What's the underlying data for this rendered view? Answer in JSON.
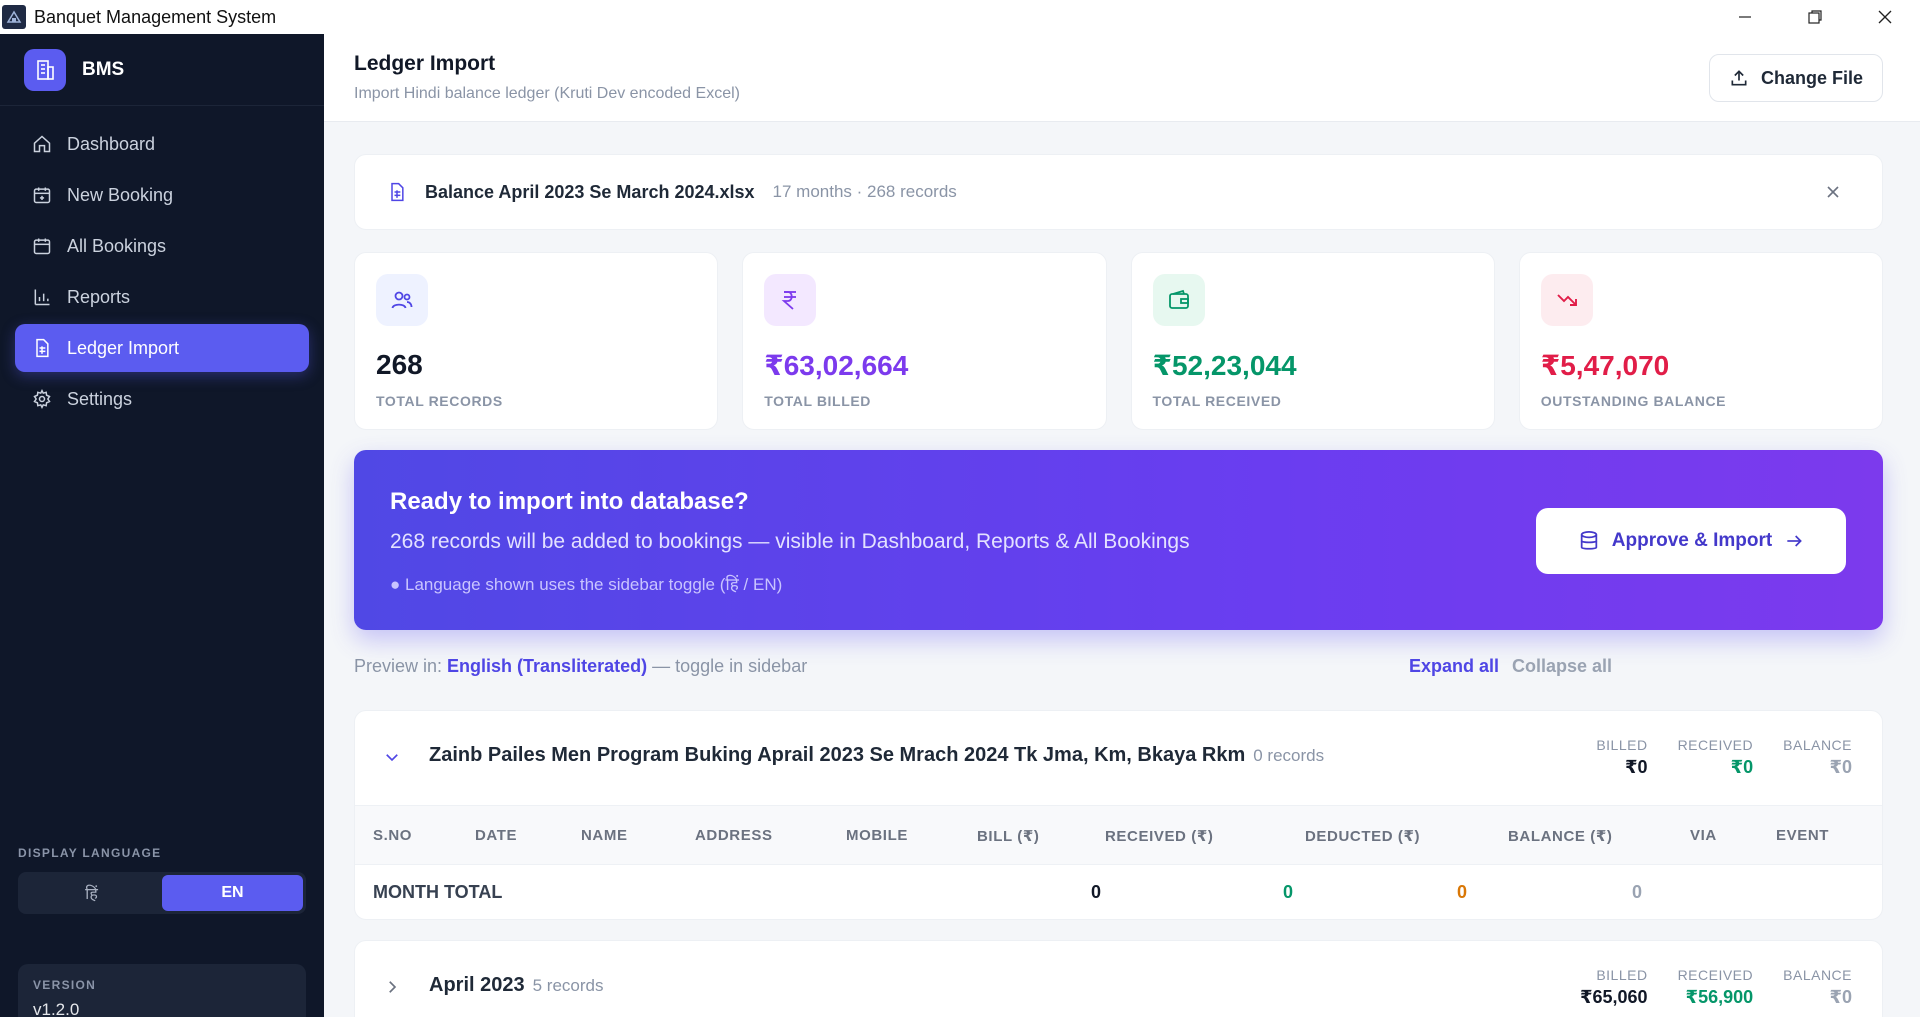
{
  "window": {
    "title": "Banquet Management System"
  },
  "sidebar": {
    "brand": "BMS",
    "items": [
      {
        "label": "Dashboard",
        "icon": "home-icon"
      },
      {
        "label": "New Booking",
        "icon": "calendar-plus-icon"
      },
      {
        "label": "All Bookings",
        "icon": "calendar-icon"
      },
      {
        "label": "Reports",
        "icon": "bar-chart-icon"
      },
      {
        "label": "Ledger Import",
        "icon": "file-spreadsheet-icon",
        "active": true
      },
      {
        "label": "Settings",
        "icon": "gear-icon"
      }
    ],
    "language": {
      "label": "DISPLAY LANGUAGE",
      "options": [
        "हिं",
        "EN"
      ],
      "selected": "EN"
    },
    "version": {
      "label": "VERSION",
      "value": "v1.2.0"
    }
  },
  "header": {
    "title": "Ledger Import",
    "subtitle": "Import Hindi balance ledger (Kruti Dev encoded Excel)",
    "change_file_label": "Change File"
  },
  "file": {
    "name": "Balance April 2023 Se March 2024.xlsx",
    "meta": "17 months · 268 records"
  },
  "stats": [
    {
      "value": "268",
      "label": "TOTAL RECORDS",
      "color": "#111827",
      "icon": "users-icon",
      "icon_bg": "#eef2ff",
      "icon_color": "#4f46e5"
    },
    {
      "value": "₹63,02,664",
      "label": "TOTAL BILLED",
      "color": "#7c3aed",
      "icon": "rupee-icon",
      "icon_bg": "#f3e8ff",
      "icon_color": "#7c3aed"
    },
    {
      "value": "₹52,23,044",
      "label": "TOTAL RECEIVED",
      "color": "#059669",
      "icon": "wallet-icon",
      "icon_bg": "#e7f8f0",
      "icon_color": "#059669"
    },
    {
      "value": "₹5,47,070",
      "label": "OUTSTANDING BALANCE",
      "color": "#e11d48",
      "icon": "trending-down-icon",
      "icon_bg": "#fdecef",
      "icon_color": "#e11d48"
    }
  ],
  "banner": {
    "title": "Ready to import into database?",
    "description": "268 records will be added to bookings — visible in Dashboard, Reports & All Bookings",
    "note": "● Language shown uses the sidebar toggle (हिं / EN)",
    "button_label": "Approve & Import"
  },
  "preview": {
    "label": "Preview in:",
    "language": "English (Transliterated)",
    "suffix": "— toggle in sidebar",
    "expand_all": "Expand all",
    "collapse_all": "Collapse all"
  },
  "groups": [
    {
      "title": "Zainb Pailes Men Program Buking Aprail 2023 Se Mrach 2024 Tk Jma, Km, Bkaya Rkm",
      "count": "0 records",
      "expanded": true,
      "billed_label": "BILLED",
      "billed": "₹0",
      "received_label": "RECEIVED",
      "received": "₹0",
      "balance_label": "BALANCE",
      "balance": "₹0",
      "columns": [
        "S.NO",
        "DATE",
        "NAME",
        "ADDRESS",
        "MOBILE",
        "BILL (₹)",
        "RECEIVED (₹)",
        "DEDUCTED (₹)",
        "BALANCE (₹)",
        "VIA",
        "EVENT"
      ],
      "total": {
        "label": "MONTH TOTAL",
        "bill": "0",
        "received": "0",
        "deducted": "0",
        "balance": "0"
      }
    },
    {
      "title": "April 2023",
      "count": "5 records",
      "expanded": false,
      "billed_label": "BILLED",
      "billed": "₹65,060",
      "received_label": "RECEIVED",
      "received": "₹56,900",
      "balance_label": "BALANCE",
      "balance": "₹0"
    }
  ],
  "colors": {
    "accent": "#5b5cf0",
    "sidebar_bg": "#0f1729",
    "green": "#059669",
    "orange": "#d97706",
    "red": "#e11d48"
  }
}
